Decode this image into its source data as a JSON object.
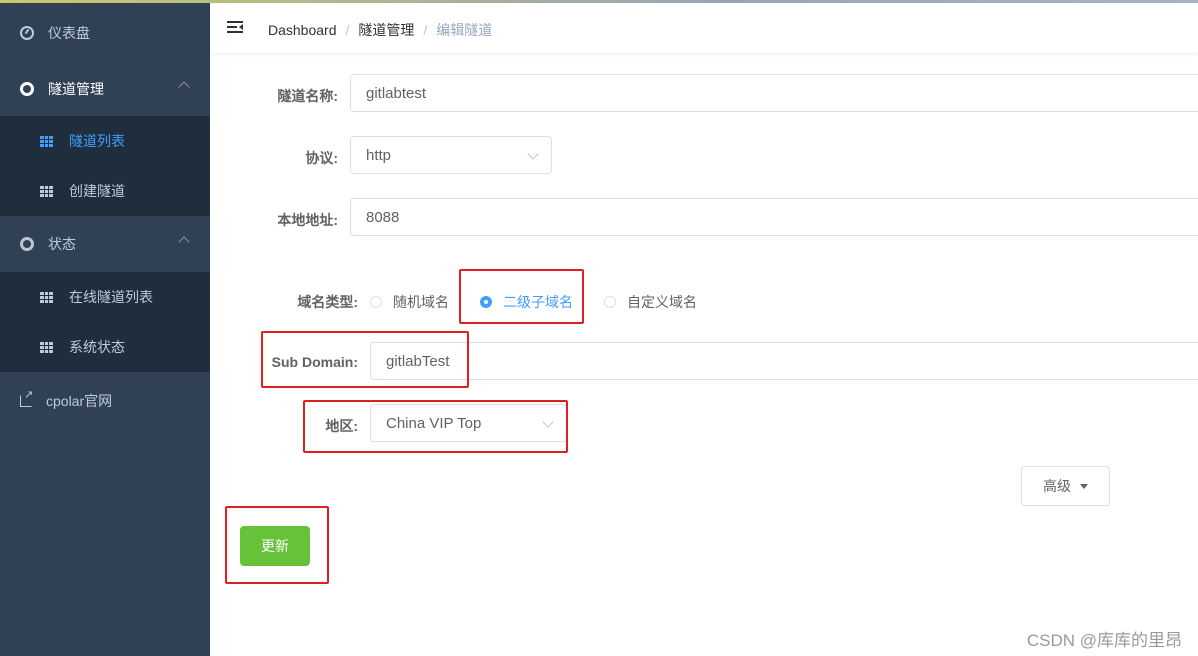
{
  "sidebar": {
    "dashboard": "仪表盘",
    "tunnel_mgmt": "隧道管理",
    "tunnel_list": "隧道列表",
    "create_tunnel": "创建隧道",
    "status": "状态",
    "online_tunnels": "在线隧道列表",
    "system_status": "系统状态",
    "cpolar_site": "cpolar官网"
  },
  "breadcrumb": {
    "home": "Dashboard",
    "sep": "/",
    "section": "隧道管理",
    "current": "编辑隧道"
  },
  "form": {
    "name_label": "隧道名称:",
    "name_value": "gitlabtest",
    "protocol_label": "协议:",
    "protocol_value": "http",
    "local_label": "本地地址:",
    "local_value": "8088",
    "domain_type_label": "域名类型:",
    "domain_options": [
      "随机域名",
      "二级子域名",
      "自定义域名"
    ],
    "domain_selected": "二级子域名",
    "subdomain_label": "Sub Domain:",
    "subdomain_value": "gitlabTest",
    "region_label": "地区:",
    "region_value": "China VIP Top",
    "advanced_button": "高级",
    "update_button": "更新"
  },
  "watermark": "CSDN @库库的里昂",
  "colors": {
    "sidebar_bg": "#304156",
    "submenu_bg": "#1f2d3d",
    "primary": "#409eff",
    "success": "#67c23a",
    "highlight": "#e02020"
  }
}
